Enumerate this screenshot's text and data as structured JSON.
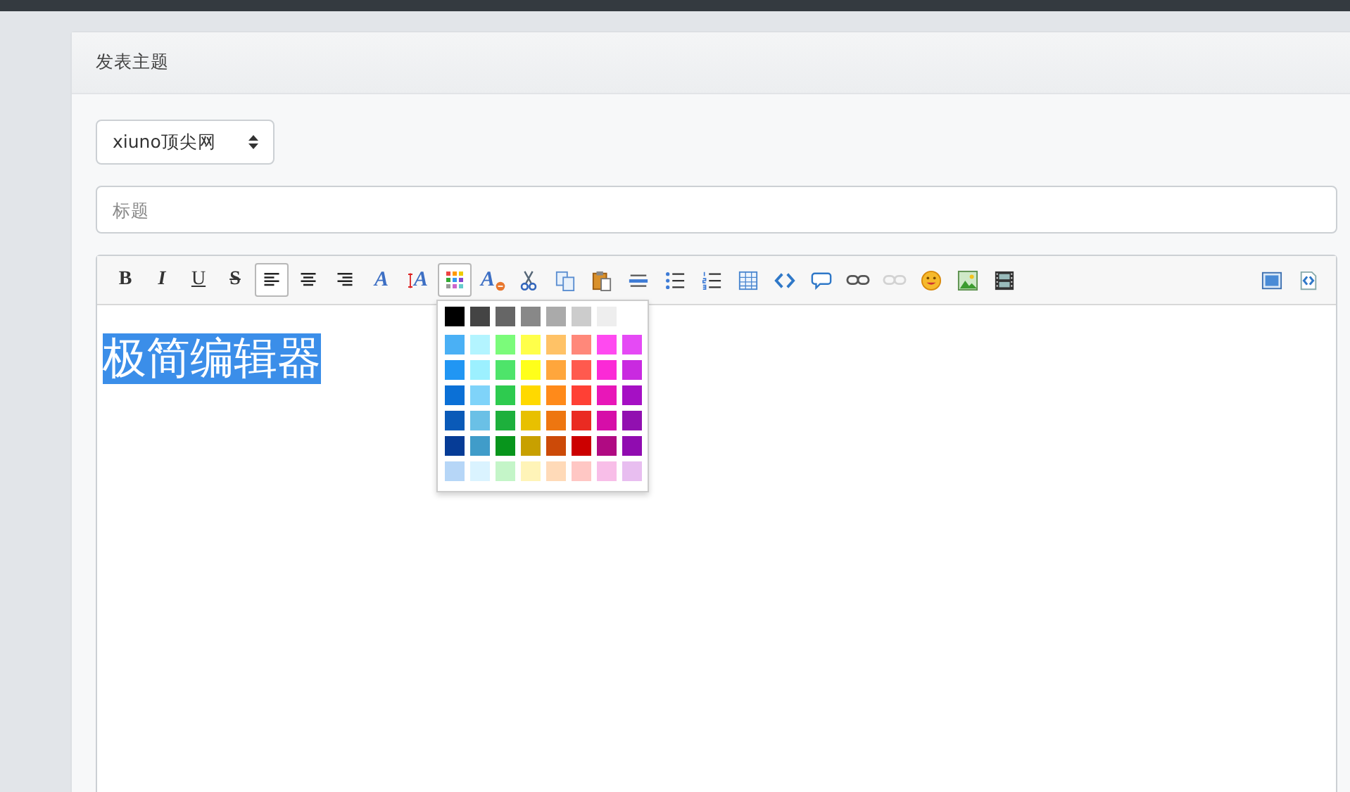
{
  "card": {
    "title": "发表主题"
  },
  "forum_select": {
    "value": "xiuno顶尖网"
  },
  "title_field": {
    "placeholder": "标题"
  },
  "editor": {
    "toolbar_left": [
      {
        "kind": "bold",
        "label": "B",
        "selected": false,
        "disabled": false
      },
      {
        "kind": "italic",
        "label": "I",
        "selected": false,
        "disabled": false
      },
      {
        "kind": "underline",
        "label": "U",
        "selected": false,
        "disabled": false
      },
      {
        "kind": "strike",
        "label": "S",
        "selected": false,
        "disabled": false
      },
      {
        "kind": "align-left",
        "selected": true,
        "disabled": false
      },
      {
        "kind": "align-center",
        "selected": false,
        "disabled": false
      },
      {
        "kind": "align-right",
        "selected": false,
        "disabled": false
      },
      {
        "kind": "font",
        "label": "A",
        "selected": false,
        "disabled": false
      },
      {
        "kind": "direction",
        "label": "A",
        "selected": false,
        "disabled": false
      },
      {
        "kind": "color",
        "selected": true,
        "disabled": false
      },
      {
        "kind": "clear-format",
        "label": "A",
        "selected": false,
        "disabled": false
      },
      {
        "kind": "cut",
        "selected": false,
        "disabled": false
      },
      {
        "kind": "copy",
        "selected": false,
        "disabled": false
      },
      {
        "kind": "paste",
        "selected": false,
        "disabled": false
      },
      {
        "kind": "rule",
        "selected": false,
        "disabled": false
      },
      {
        "kind": "bullet-list",
        "selected": false,
        "disabled": false
      },
      {
        "kind": "number-list",
        "selected": false,
        "disabled": false
      },
      {
        "kind": "table",
        "selected": false,
        "disabled": false
      },
      {
        "kind": "code",
        "selected": false,
        "disabled": false
      },
      {
        "kind": "comment",
        "selected": false,
        "disabled": false
      },
      {
        "kind": "link",
        "selected": false,
        "disabled": false
      },
      {
        "kind": "unlink",
        "selected": false,
        "disabled": true
      },
      {
        "kind": "emoji",
        "selected": false,
        "disabled": false
      },
      {
        "kind": "image",
        "selected": false,
        "disabled": false
      },
      {
        "kind": "video",
        "selected": false,
        "disabled": false
      }
    ],
    "toolbar_right": [
      {
        "kind": "fullscreen",
        "selected": false,
        "disabled": false
      },
      {
        "kind": "source",
        "selected": false,
        "disabled": false
      }
    ],
    "content": {
      "text": "极简编辑器",
      "selected": true
    },
    "color_palette": [
      [
        {
          "color": "#000000"
        },
        {
          "color": "#444444"
        },
        {
          "color": "#666666"
        },
        {
          "color": "#888888"
        },
        {
          "color": "#aaaaaa"
        },
        {
          "color": "#cccccc"
        },
        {
          "color": "#eeeeee"
        }
      ],
      [
        {
          "color": "#4ab0f5"
        },
        {
          "color": "#b3f4ff"
        },
        {
          "color": "#7bfb7a"
        },
        {
          "color": "#ffff4a"
        },
        {
          "color": "#ffc266"
        },
        {
          "color": "#ff887a"
        },
        {
          "color": "#ff4af0"
        },
        {
          "color": "#e54af5"
        }
      ],
      [
        {
          "color": "#2196f3"
        },
        {
          "color": "#9cf0ff"
        },
        {
          "color": "#4ee46a"
        },
        {
          "color": "#ffff1a"
        },
        {
          "color": "#ffa63c"
        },
        {
          "color": "#ff5a4e"
        },
        {
          "color": "#fb2ad6"
        },
        {
          "color": "#c92ae0"
        }
      ],
      [
        {
          "color": "#0b70d6"
        },
        {
          "color": "#7fd3f9"
        },
        {
          "color": "#2ecb4f"
        },
        {
          "color": "#ffd900"
        },
        {
          "color": "#ff8a1a"
        },
        {
          "color": "#ff4035"
        },
        {
          "color": "#e817b8"
        },
        {
          "color": "#a510c4"
        }
      ],
      [
        {
          "color": "#0a5ab8"
        },
        {
          "color": "#6ac0e6"
        },
        {
          "color": "#1db03c"
        },
        {
          "color": "#e8c000"
        },
        {
          "color": "#ee7610"
        },
        {
          "color": "#ea2b22"
        },
        {
          "color": "#d60ea8"
        },
        {
          "color": "#9110b0"
        }
      ],
      [
        {
          "color": "#063c96"
        },
        {
          "color": "#409cc9"
        },
        {
          "color": "#08951c"
        },
        {
          "color": "#c8a000"
        },
        {
          "color": "#cc4a08"
        },
        {
          "color": "#cc0000"
        },
        {
          "color": "#b00a82"
        },
        {
          "color": "#900cb0"
        }
      ],
      [
        {
          "color": "#b6d6f7"
        },
        {
          "color": "#daf3ff"
        },
        {
          "color": "#c4f5c8"
        },
        {
          "color": "#fff4b8"
        },
        {
          "color": "#ffdab8"
        },
        {
          "color": "#ffc7c4"
        },
        {
          "color": "#f8bee8"
        },
        {
          "color": "#e8bef0"
        }
      ]
    ]
  }
}
